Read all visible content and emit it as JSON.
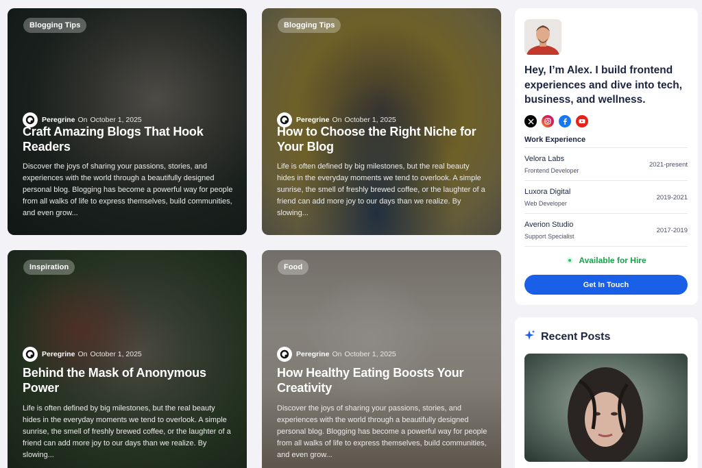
{
  "posts": [
    {
      "category": "Blogging Tips",
      "author": "Peregrine",
      "on": "On",
      "date": "October 1, 2025",
      "title": "Craft Amazing Blogs That Hook Readers",
      "excerpt": "Discover the joys of sharing your passions, stories, and experiences with the world through a beautifully designed personal blog. Blogging has become a powerful way for people from all walks of life to express themselves, build communities, and even grow..."
    },
    {
      "category": "Blogging Tips",
      "author": "Peregrine",
      "on": "On",
      "date": "October 1, 2025",
      "title": "How to Choose the Right Niche for Your Blog",
      "excerpt": "Life is often defined by big milestones, but the real beauty hides in the everyday moments we tend to overlook. A simple sunrise, the smell of freshly brewed coffee, or the laughter of a friend can add more joy to our days than we realize. By slowing..."
    },
    {
      "category": "Inspiration",
      "author": "Peregrine",
      "on": "On",
      "date": "October 1, 2025",
      "title": "Behind the Mask of Anonymous Power",
      "excerpt": "Life is often defined by big milestones, but the real beauty hides in the everyday moments we tend to overlook. A simple sunrise, the smell of freshly brewed coffee, or the laughter of a friend can add more joy to our days than we realize. By slowing..."
    },
    {
      "category": "Food",
      "author": "Peregrine",
      "on": "On",
      "date": "October 1, 2025",
      "title": "How Healthy Eating Boosts Your Creativity",
      "excerpt": "Discover the joys of sharing your passions, stories, and experiences with the world through a beautifully designed personal blog. Blogging has become a powerful way for people from all walks of life to express themselves, build communities, and even grow..."
    }
  ],
  "profile": {
    "intro": "Hey, I’m Alex. I build frontend experiences and dive into tech, business, and wellness.",
    "socials": [
      "x-icon",
      "instagram-icon",
      "facebook-icon",
      "youtube-icon"
    ],
    "work_heading": "Work Experience",
    "jobs": [
      {
        "company": "Velora Labs",
        "role": "Frontend Developer",
        "years": "2021-present"
      },
      {
        "company": "Luxora Digital",
        "role": "Web Developer",
        "years": "2019-2021"
      },
      {
        "company": "Averion Studio",
        "role": "Support Specialist",
        "years": "2017-2019"
      }
    ],
    "availability": "Available for Hire",
    "cta": "Get In Touch"
  },
  "recent": {
    "title": "Recent Posts"
  },
  "colors": {
    "accent": "#1a5fe8",
    "available": "#16a34a",
    "text_dark": "#1b2440",
    "background": "#f2f2f7"
  }
}
